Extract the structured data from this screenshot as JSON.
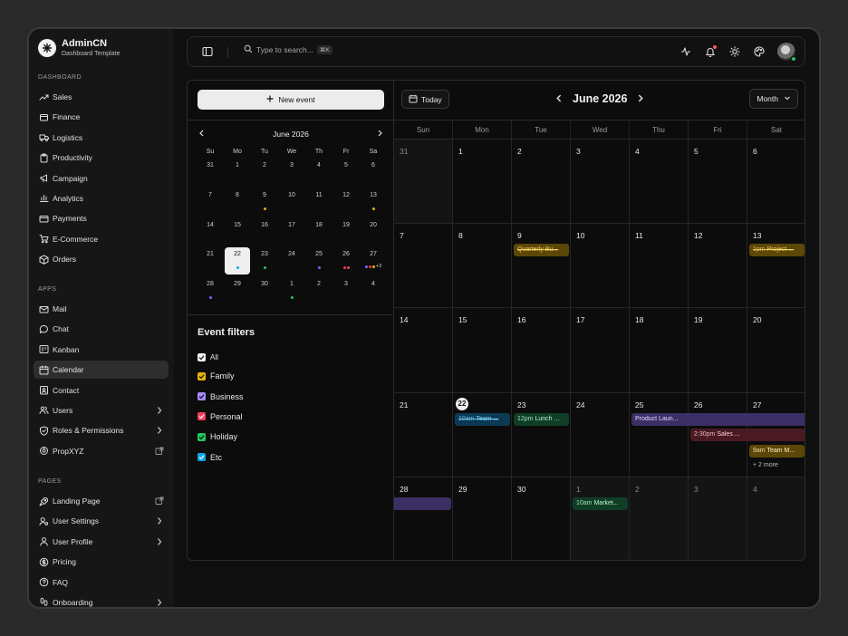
{
  "brand": {
    "title": "AdminCN",
    "subtitle": "Dashboard Template"
  },
  "sidebar": {
    "sections": [
      {
        "label": "DASHBOARD",
        "items": [
          {
            "label": "Sales",
            "icon": "trending-up-icon"
          },
          {
            "label": "Finance",
            "icon": "wallet-icon"
          },
          {
            "label": "Logistics",
            "icon": "truck-icon"
          },
          {
            "label": "Productivity",
            "icon": "clipboard-icon"
          },
          {
            "label": "Campaign",
            "icon": "megaphone-icon"
          },
          {
            "label": "Analytics",
            "icon": "bar-chart-icon"
          },
          {
            "label": "Payments",
            "icon": "credit-card-icon"
          },
          {
            "label": "E-Commerce",
            "icon": "cart-icon"
          },
          {
            "label": "Orders",
            "icon": "box-icon"
          }
        ]
      },
      {
        "label": "APPS",
        "items": [
          {
            "label": "Mail",
            "icon": "mail-icon"
          },
          {
            "label": "Chat",
            "icon": "chat-icon"
          },
          {
            "label": "Kanban",
            "icon": "kanban-icon"
          },
          {
            "label": "Calendar",
            "icon": "calendar-icon",
            "active": true
          },
          {
            "label": "Contact",
            "icon": "contact-icon"
          },
          {
            "label": "Users",
            "icon": "users-icon",
            "trail": "chevron"
          },
          {
            "label": "Roles & Permissions",
            "icon": "shield-icon",
            "trail": "chevron"
          },
          {
            "label": "PropXYZ",
            "icon": "prop-icon",
            "trail": "external"
          }
        ]
      },
      {
        "label": "PAGES",
        "items": [
          {
            "label": "Landing Page",
            "icon": "rocket-icon",
            "trail": "external"
          },
          {
            "label": "User Settings",
            "icon": "user-cog-icon",
            "trail": "chevron"
          },
          {
            "label": "User Profile",
            "icon": "user-icon",
            "trail": "chevron"
          },
          {
            "label": "Pricing",
            "icon": "dollar-icon"
          },
          {
            "label": "FAQ",
            "icon": "help-icon"
          },
          {
            "label": "Onboarding",
            "icon": "footprints-icon",
            "trail": "chevron"
          }
        ]
      }
    ]
  },
  "topbar": {
    "search_placeholder": "Type to search...",
    "search_shortcut": "⌘K"
  },
  "calendar": {
    "new_event_label": "New event",
    "mini": {
      "title": "June 2026",
      "dow": [
        "Su",
        "Mo",
        "Tu",
        "We",
        "Th",
        "Fr",
        "Sa"
      ],
      "weeks": [
        [
          {
            "d": "31"
          },
          {
            "d": "1"
          },
          {
            "d": "2"
          },
          {
            "d": "3"
          },
          {
            "d": "4"
          },
          {
            "d": "5"
          },
          {
            "d": "6"
          }
        ],
        [
          {
            "d": "7"
          },
          {
            "d": "8"
          },
          {
            "d": "9",
            "dots": [
              "#eab308"
            ]
          },
          {
            "d": "10"
          },
          {
            "d": "11"
          },
          {
            "d": "12"
          },
          {
            "d": "13",
            "dots": [
              "#eab308"
            ]
          }
        ],
        [
          {
            "d": "14"
          },
          {
            "d": "15"
          },
          {
            "d": "16"
          },
          {
            "d": "17"
          },
          {
            "d": "18"
          },
          {
            "d": "19"
          },
          {
            "d": "20"
          }
        ],
        [
          {
            "d": "21"
          },
          {
            "d": "22",
            "selected": true,
            "dots": [
              "#0ea5e9"
            ]
          },
          {
            "d": "23",
            "dots": [
              "#22c55e"
            ]
          },
          {
            "d": "24"
          },
          {
            "d": "25",
            "dots": [
              "#8b5cf6"
            ]
          },
          {
            "d": "26",
            "dots": [
              "#f43f5e",
              "#f43f5e"
            ]
          },
          {
            "d": "27",
            "dots": [
              "#8b5cf6",
              "#f43f5e",
              "#eab308"
            ],
            "more": "+3"
          }
        ],
        [
          {
            "d": "28",
            "dots": [
              "#8b5cf6"
            ]
          },
          {
            "d": "29"
          },
          {
            "d": "30"
          },
          {
            "d": "1",
            "dots": [
              "#22c55e"
            ]
          },
          {
            "d": "2"
          },
          {
            "d": "3"
          },
          {
            "d": "4"
          }
        ]
      ]
    },
    "filters_title": "Event filters",
    "filters": [
      {
        "label": "All",
        "color": "#f2f2f2",
        "check": "#111111"
      },
      {
        "label": "Family",
        "color": "#eab308",
        "check": "#111111"
      },
      {
        "label": "Business",
        "color": "#a78bfa",
        "check": "#111111"
      },
      {
        "label": "Personal",
        "color": "#f43f5e",
        "check": "#ffffff"
      },
      {
        "label": "Holiday",
        "color": "#22c55e",
        "check": "#111111"
      },
      {
        "label": "Etc",
        "color": "#0ea5e9",
        "check": "#ffffff"
      }
    ],
    "today_label": "Today",
    "month_title": "June 2026",
    "view_label": "Month",
    "dow": [
      "Sun",
      "Mon",
      "Tue",
      "Wed",
      "Thu",
      "Fri",
      "Sat"
    ],
    "weeks": [
      [
        {
          "d": "31",
          "out": true
        },
        {
          "d": "1"
        },
        {
          "d": "2"
        },
        {
          "d": "3"
        },
        {
          "d": "4"
        },
        {
          "d": "5"
        },
        {
          "d": "6"
        }
      ],
      [
        {
          "d": "7"
        },
        {
          "d": "8"
        },
        {
          "d": "9"
        },
        {
          "d": "10"
        },
        {
          "d": "11"
        },
        {
          "d": "12"
        },
        {
          "d": "13"
        }
      ],
      [
        {
          "d": "14"
        },
        {
          "d": "15"
        },
        {
          "d": "16"
        },
        {
          "d": "17"
        },
        {
          "d": "18"
        },
        {
          "d": "19"
        },
        {
          "d": "20"
        }
      ],
      [
        {
          "d": "21"
        },
        {
          "d": "22",
          "today": true
        },
        {
          "d": "23"
        },
        {
          "d": "24"
        },
        {
          "d": "25"
        },
        {
          "d": "26"
        },
        {
          "d": "27"
        }
      ],
      [
        {
          "d": "28"
        },
        {
          "d": "29"
        },
        {
          "d": "30"
        },
        {
          "d": "1",
          "out": true
        },
        {
          "d": "2",
          "out": true
        },
        {
          "d": "3",
          "out": true
        },
        {
          "d": "4",
          "out": true
        }
      ]
    ],
    "events": [
      {
        "week": 1,
        "col": 2,
        "span": 1,
        "row": 0,
        "text": "Quarterly Bu...",
        "bg": "#5c4708",
        "fg": "#f4d35e",
        "strike": true
      },
      {
        "week": 1,
        "col": 6,
        "span": 1,
        "row": 0,
        "time": "1pm",
        "text": "Project ...",
        "bg": "#5c4708",
        "fg": "#f4d35e",
        "strike": true
      },
      {
        "week": 3,
        "col": 1,
        "span": 1,
        "row": 0,
        "time": "10am",
        "text": "Team ...",
        "bg": "#0c3a54",
        "fg": "#7dd3fc",
        "strike": true
      },
      {
        "week": 3,
        "col": 2,
        "span": 1,
        "row": 0,
        "time": "12pm",
        "text": "Lunch ...",
        "bg": "#0f3d25",
        "fg": "#bbf7d0"
      },
      {
        "week": 3,
        "col": 4,
        "span": 3,
        "row": 0,
        "text": "Product Laun...",
        "bg": "#3b2f66",
        "fg": "#e4dcff",
        "continues": true
      },
      {
        "week": 3,
        "col": 5,
        "span": 2,
        "row": 1,
        "time": "2:30pm",
        "text": "Sales ...",
        "bg": "#4a1a22",
        "fg": "#fecdd3",
        "continues": true
      },
      {
        "week": 3,
        "col": 6,
        "span": 1,
        "row": 2,
        "time": "9am",
        "text": "Team M...",
        "bg": "#5c4708",
        "fg": "#fff3c4"
      },
      {
        "week": 4,
        "col": 0,
        "span": 1,
        "row": 0,
        "text": "",
        "bg": "#3b2f66",
        "fg": "#e4dcff",
        "continued": true
      },
      {
        "week": 4,
        "col": 3,
        "span": 1,
        "row": 0,
        "time": "10am",
        "text": "Market...",
        "bg": "#0f3d25",
        "fg": "#bbf7d0"
      }
    ],
    "more_links": [
      {
        "week": 3,
        "col": 6,
        "row": 3,
        "text": "+ 2 more"
      }
    ]
  }
}
